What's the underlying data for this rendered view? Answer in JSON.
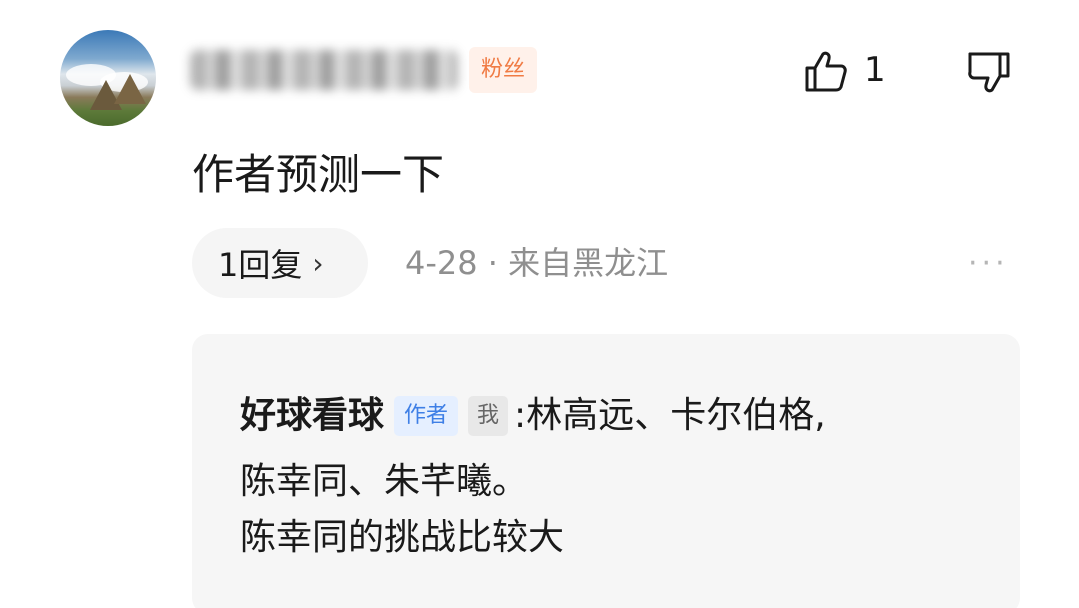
{
  "comment": {
    "badge": "粉丝",
    "like_count": "1",
    "text": "作者预测一下",
    "reply_count_label": "1回复",
    "reply_chevron": "›",
    "meta": "4-28 · 来自黑龙江",
    "more": "···"
  },
  "reply": {
    "author": "好球看球",
    "tag_author": "作者",
    "tag_me": "我",
    "colon": ":",
    "lines": [
      "林高远、卡尔伯格,",
      "陈幸同、朱芊曦。",
      "陈幸同的挑战比较大"
    ]
  },
  "icons": {
    "like": "thumbs-up-icon",
    "dislike": "thumbs-down-icon",
    "more": "more-dots-icon"
  },
  "colors": {
    "badge_text": "#f07b44",
    "badge_bg": "#fff1ea",
    "author_tag_text": "#3e7fe6",
    "author_tag_bg": "#e5efff",
    "meta_text": "#8f8f8f",
    "reply_bg": "#f6f6f6"
  }
}
